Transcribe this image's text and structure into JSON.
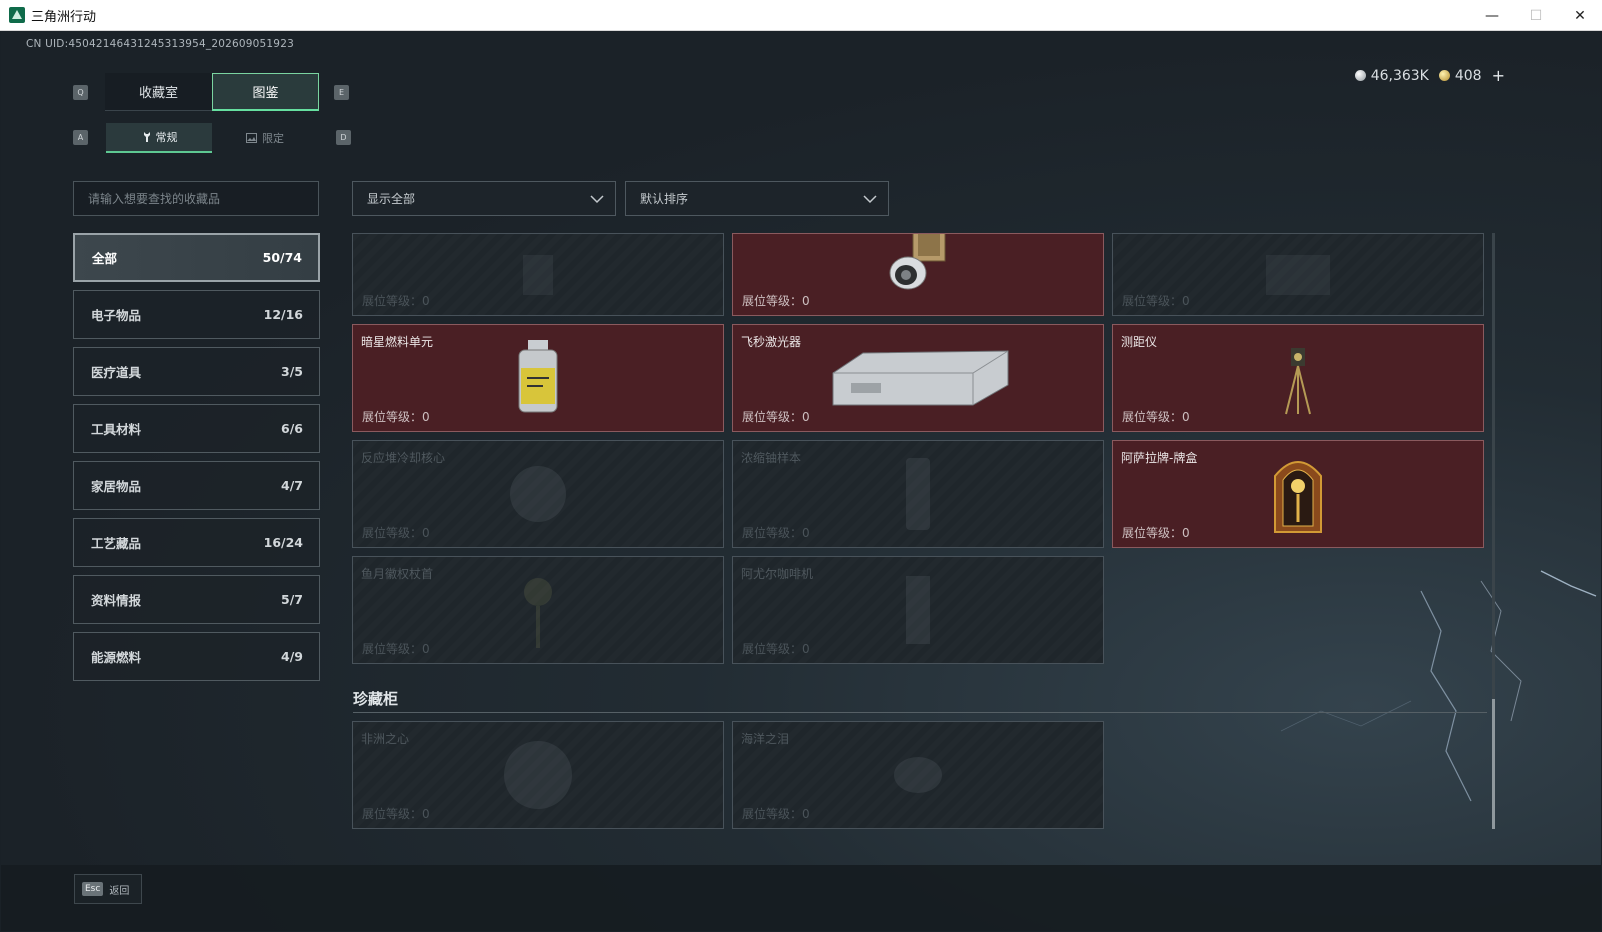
{
  "window": {
    "title": "三角洲行动",
    "controls": {
      "minimize": "—",
      "maximize": "☐",
      "close": "✕"
    }
  },
  "uid": "CN UID:450421464312453139​54_202609051923",
  "currency": {
    "silver": "46,363K",
    "gold": "408",
    "add": "+"
  },
  "keys": {
    "tab_prev": "Q",
    "tab_next": "E",
    "sub_prev": "A",
    "sub_next": "D"
  },
  "tabs": [
    {
      "label": "收藏室",
      "active": false
    },
    {
      "label": "图鉴",
      "active": true
    }
  ],
  "subtabs": [
    {
      "label": "常规",
      "icon": "wrench-icon",
      "active": true
    },
    {
      "label": "限定",
      "icon": "image-icon",
      "active": false
    }
  ],
  "search": {
    "placeholder": "请输入想要查找的收藏品"
  },
  "filters": {
    "show": "显示全部",
    "sort": "默认排序"
  },
  "categories": [
    {
      "label": "全部",
      "count": "50/74",
      "active": true
    },
    {
      "label": "电子物品",
      "count": "12/16"
    },
    {
      "label": "医疗道具",
      "count": "3/5"
    },
    {
      "label": "工具材料",
      "count": "6/6"
    },
    {
      "label": "家居物品",
      "count": "4/7"
    },
    {
      "label": "工艺藏品",
      "count": "16/24"
    },
    {
      "label": "资料情报",
      "count": "5/7"
    },
    {
      "label": "能源燃料",
      "count": "4/9"
    }
  ],
  "level_label": "展位等级：0",
  "items": [
    {
      "name": "",
      "owned": false
    },
    {
      "name": "",
      "owned": true
    },
    {
      "name": "",
      "owned": false
    },
    {
      "name": "暗星燃料单元",
      "owned": true
    },
    {
      "name": "飞秒激光器",
      "owned": true
    },
    {
      "name": "测距仪",
      "owned": true
    },
    {
      "name": "反应堆冷却核心",
      "owned": false
    },
    {
      "name": "浓缩铀样本",
      "owned": false
    },
    {
      "name": "阿萨拉牌-牌盒",
      "owned": true
    },
    {
      "name": "鱼月徽权杖首",
      "owned": false
    },
    {
      "name": "阿尤尔咖啡机",
      "owned": false
    }
  ],
  "cabinet": {
    "title": "珍藏柜",
    "items": [
      {
        "name": "非洲之心",
        "owned": false
      },
      {
        "name": "海洋之泪",
        "owned": false
      }
    ]
  },
  "footer": {
    "key": "Esc",
    "label": "返回"
  },
  "colors": {
    "owned_card": "#4a1f24",
    "accent_green": "#66e0a0",
    "background": "#1a2127"
  }
}
